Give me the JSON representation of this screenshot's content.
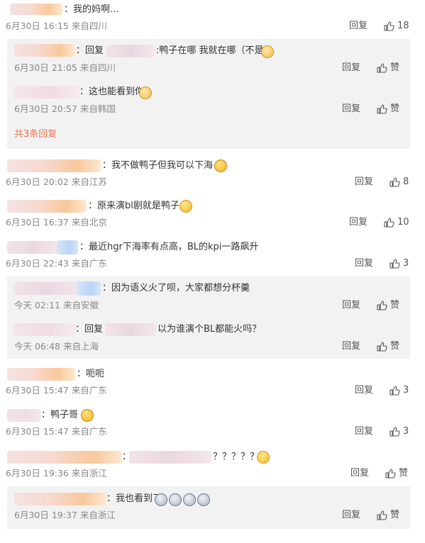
{
  "comments": [
    {
      "text": "：我的妈啊...",
      "meta": "6月30日 16:15 来自四川",
      "reply": "回复",
      "likes": "18",
      "sub_replies": [
        {
          "text": "：回复",
          "text2": ":鸭子在哪 我就在哪（不是",
          "meta": "6月30日 21:05 来自四川",
          "reply": "回复",
          "likes": "赞"
        },
        {
          "text": "：这也能看到你",
          "meta": "6月30日 20:57 来自韩国",
          "reply": "回复",
          "likes": "赞"
        }
      ],
      "more": "共3条回复"
    },
    {
      "text": "：我不做鸭子但我可以下海",
      "meta": "6月30日 20:02 来自江苏",
      "reply": "回复",
      "likes": "8"
    },
    {
      "text": "：原来演bl剧就是鸭子",
      "meta": "6月30日 16:37 来自北京",
      "reply": "回复",
      "likes": "10"
    },
    {
      "text": "：最近hgr下海率有点高，BL的kpi一路飙升",
      "meta": "6月30日 22:43 来自广东",
      "reply": "回复",
      "likes": "3",
      "sub_replies": [
        {
          "text": "：因为语义火了呗，大家都想分杯羹",
          "meta": "今天 02:11 来自安徽",
          "reply": "回复",
          "likes": "赞"
        },
        {
          "text": "：回复",
          "text2": "以为谁演个BL都能火吗？",
          "meta": "今天 06:48 来自上海",
          "reply": "回复",
          "likes": "赞"
        }
      ]
    },
    {
      "text": "：呃呃",
      "meta": "6月30日 15:47 来自广东",
      "reply": "回复",
      "likes": "3"
    },
    {
      "text": "：鸭子哥",
      "meta": "6月30日 15:47 来自广东",
      "reply": "回复",
      "likes": "3"
    },
    {
      "text": "：",
      "text2": "？？？？？",
      "meta": "6月30日 19:36 来自浙江",
      "reply": "回复",
      "likes": "赞",
      "sub_replies": [
        {
          "text": "：我也看到了",
          "meta": "6月30日 19:37 来自浙江",
          "reply": "回复",
          "likes": "赞"
        }
      ]
    }
  ],
  "icons": {
    "like": "thumbs-up-icon"
  }
}
